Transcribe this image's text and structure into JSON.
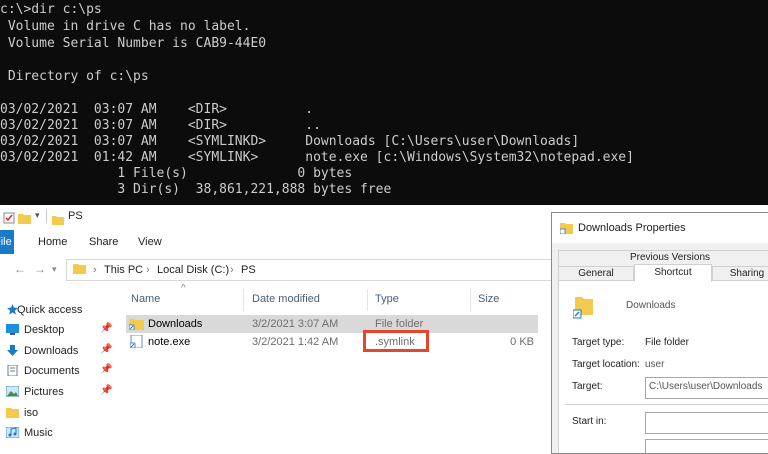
{
  "console": {
    "lines": [
      "c:\\>dir c:\\ps",
      " Volume in drive C has no label.",
      " Volume Serial Number is CAB9-44E0",
      "",
      " Directory of c:\\ps",
      "",
      "03/02/2021  03:07 AM    <DIR>          .",
      "03/02/2021  03:07 AM    <DIR>          ..",
      "03/02/2021  03:07 AM    <SYMLINKD>     Downloads [C:\\Users\\user\\Downloads]",
      "03/02/2021  01:42 AM    <SYMLINK>      note.exe [c:\\Windows\\System32\\notepad.exe]",
      "               1 File(s)              0 bytes",
      "               3 Dir(s)  38,861,221,888 bytes free"
    ]
  },
  "explorer": {
    "title": "PS",
    "ribbon": {
      "file": "File",
      "tabs": [
        "Home",
        "Share",
        "View"
      ]
    },
    "breadcrumb": [
      "This PC",
      "Local Disk (C:)",
      "PS"
    ],
    "nav_items": [
      {
        "label": "Quick access",
        "icon": "star-icon",
        "pinned": false
      },
      {
        "label": "Desktop",
        "icon": "desktop-icon",
        "pinned": true
      },
      {
        "label": "Downloads",
        "icon": "download-icon",
        "pinned": true
      },
      {
        "label": "Documents",
        "icon": "documents-icon",
        "pinned": true
      },
      {
        "label": "Pictures",
        "icon": "pictures-icon",
        "pinned": true
      },
      {
        "label": "iso",
        "icon": "folder-icon",
        "pinned": false
      },
      {
        "label": "Music",
        "icon": "music-icon",
        "pinned": false
      }
    ],
    "columns": [
      "Name",
      "Date modified",
      "Type",
      "Size"
    ],
    "files": [
      {
        "name": "Downloads",
        "date": "3/2/2021 3:07 AM",
        "type": "File folder",
        "size": ""
      },
      {
        "name": "note.exe",
        "date": "3/2/2021 1:42 AM",
        "type": ".symlink",
        "size": "0 KB"
      }
    ]
  },
  "properties": {
    "title": "Downloads Properties",
    "tabs_top": [
      "Previous Versions"
    ],
    "tabs_bottom": [
      "General",
      "Shortcut",
      "Sharing"
    ],
    "active_tab": "Shortcut",
    "name": "Downloads",
    "target_type_label": "Target type:",
    "target_type": "File folder",
    "target_location_label": "Target location:",
    "target_location": "user",
    "target_label": "Target:",
    "target": "C:\\Users\\user\\Downloads",
    "start_in_label": "Start in:",
    "start_in": ""
  },
  "colors": {
    "console_bg": "#0c0c0c",
    "console_fg": "#cccccc",
    "accent": "#1979ca",
    "annotation": "#e8462c",
    "folder": "#f3c94e"
  }
}
